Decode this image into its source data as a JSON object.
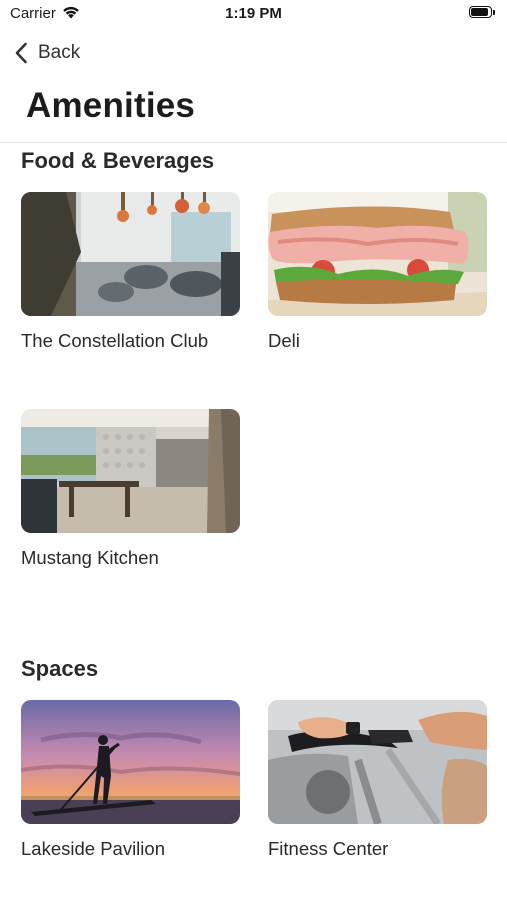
{
  "status_bar": {
    "carrier": "Carrier",
    "time": "1:19 PM"
  },
  "nav": {
    "back_label": "Back"
  },
  "page_title": "Amenities",
  "sections": [
    {
      "title": "Food & Beverages",
      "items": [
        {
          "label": "The Constellation Club",
          "icon": "restaurant-interior-photo"
        },
        {
          "label": "Deli",
          "icon": "sandwich-photo"
        },
        {
          "label": "Mustang Kitchen",
          "icon": "dining-room-photo"
        }
      ]
    },
    {
      "title": "Spaces",
      "items": [
        {
          "label": "Lakeside Pavilion",
          "icon": "paddleboard-sunset-photo"
        },
        {
          "label": "Fitness Center",
          "icon": "exercise-bike-photo"
        }
      ]
    }
  ]
}
